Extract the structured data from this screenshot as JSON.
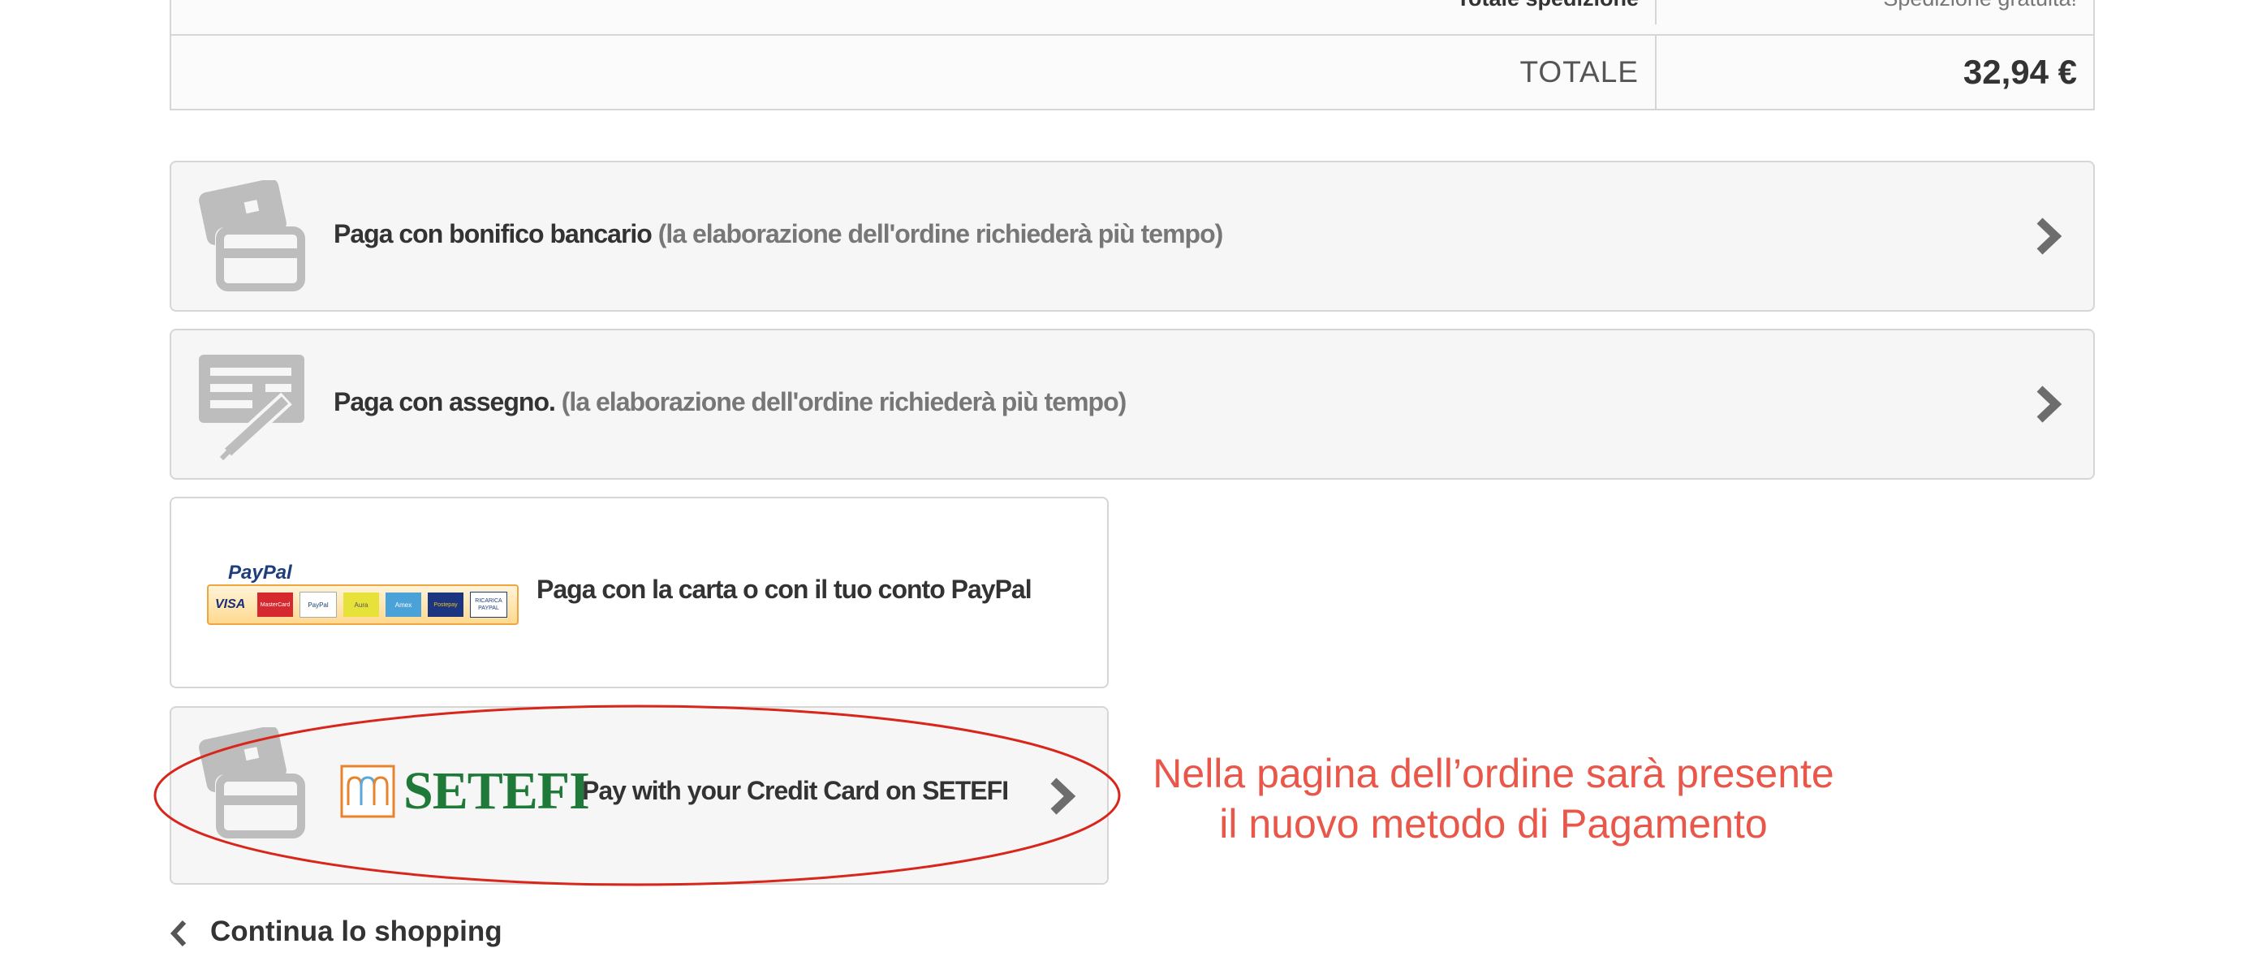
{
  "totals": {
    "shipping_label": "Totale spedizione",
    "shipping_value": "Spedizione gratuita!",
    "total_label": "TOTALE",
    "total_value": "32,94 €"
  },
  "payments": {
    "bonifico": {
      "label": "Paga con bonifico bancario",
      "note": "(la elaborazione dell'ordine richiederà più tempo)",
      "icon": "credit-card-icon"
    },
    "assegno": {
      "label": "Paga con assegno.",
      "note": "(la elaborazione dell'ordine richiederà più tempo)",
      "icon": "cheque-icon"
    },
    "paypal": {
      "logo_text": "PayPal",
      "label": "Paga con la carta o con il tuo conto PayPal",
      "card_marks": [
        "VISA",
        "MasterCard",
        "PayPal",
        "Aura",
        "Amex",
        "Postepay",
        "RICARICA PAYPAL"
      ]
    },
    "setefi": {
      "logo_text": "SETEFI",
      "label": "Pay with your Credit Card on SETEFI",
      "icon": "credit-card-icon"
    }
  },
  "annotation": {
    "line1": "Nella pagina dell’ordine sarà presente",
    "line2": "il nuovo metodo di Pagamento",
    "color": "#e8574a"
  },
  "footer": {
    "continue_label": "Continua lo shopping"
  }
}
